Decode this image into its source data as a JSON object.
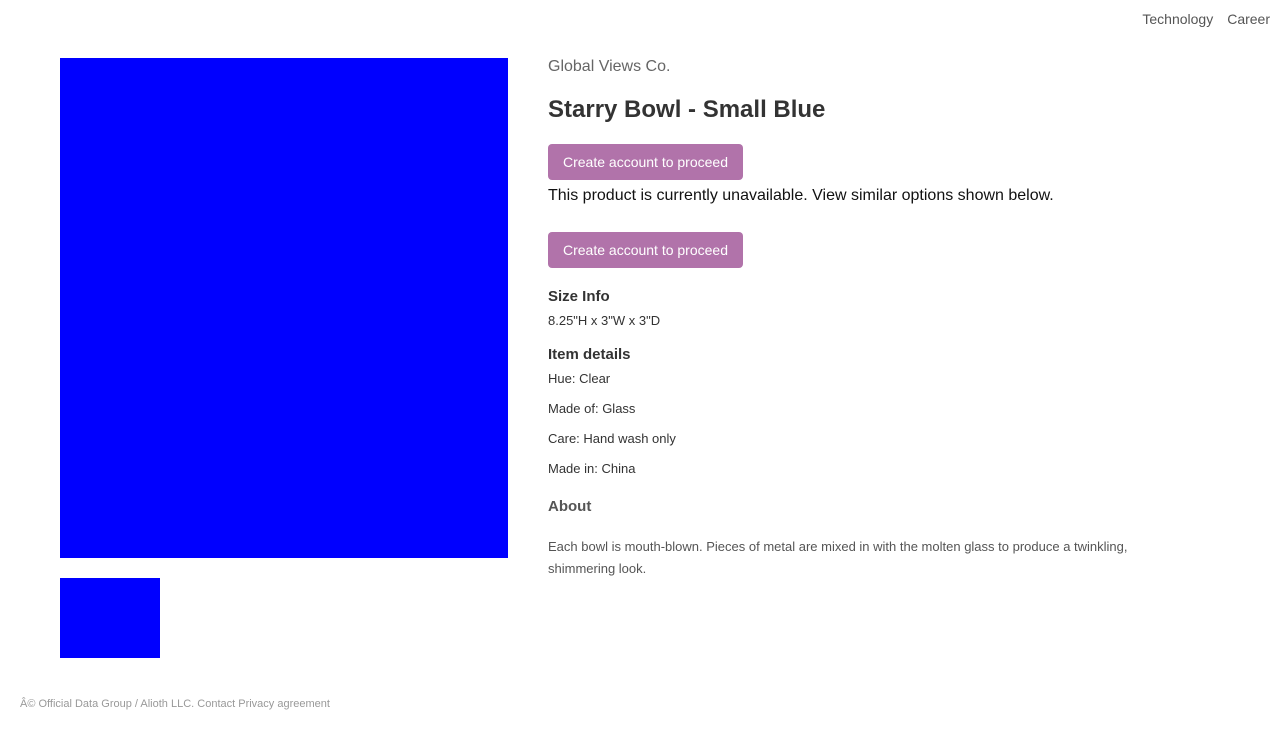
{
  "nav": {
    "items": [
      "Technology",
      "Career"
    ]
  },
  "colors": {
    "image": "#0000ff",
    "button": "#b173aa"
  },
  "product": {
    "brand": "Global Views Co.",
    "title": "Starry Bowl - Small Blue",
    "button_label": "Create account to proceed",
    "unavailable": "This product is currently unavailable. View similar options shown below.",
    "size_heading": "Size Info",
    "size": "8.25\"H x 3\"W x 3\"D",
    "details_heading": "Item details",
    "details": [
      "Hue: Clear",
      "Made of: Glass",
      "Care: Hand wash only",
      "Made in: China"
    ],
    "about_heading": "About",
    "about": "Each bowl is mouth-blown. Pieces of metal are mixed in with the molten glass to produce a twinkling, shimmering look."
  },
  "footer": {
    "text": "Â© Official Data Group / Alioth LLC. Contact Privacy agreement"
  }
}
